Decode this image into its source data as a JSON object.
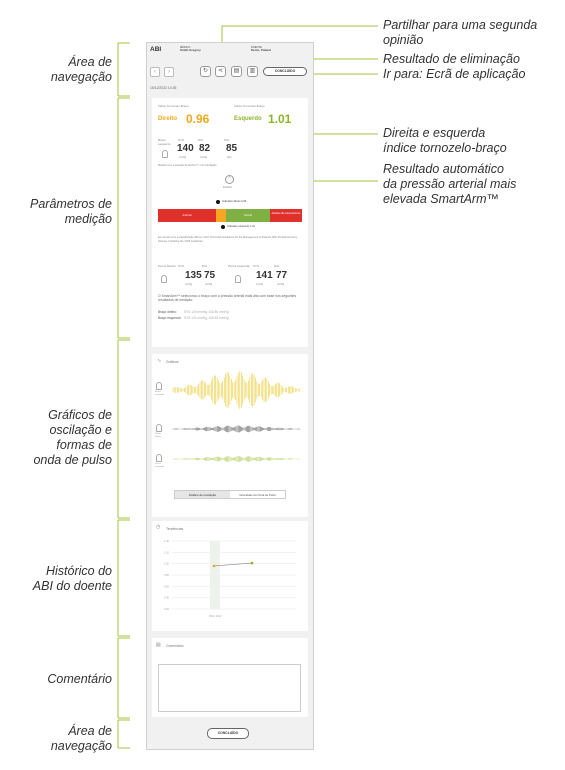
{
  "left_labels": {
    "nav_top": "Área de\nnavegação",
    "params": "Parâmetros de\nmedição",
    "graphs": "Gráficos de\noscilação e\nformas de\nonda de pulso",
    "history": "Histórico do\nABI do doente",
    "comment": "Comentário",
    "nav_bottom": "Área de\nnavegação"
  },
  "right_labels": {
    "share": "Partilhar para uma segunda\nopinião",
    "delete": "Resultado de eliminação",
    "goto": "Ir para: Ecrã de aplicação",
    "abi_index": "Direita e esquerda\níndice tornozelo-braço",
    "auto_bp": "Resultado automático\nda pressão arterial mais\nelevada SmartArm™"
  },
  "header": {
    "app_title": "ABI",
    "field1_label": "MÉDICO",
    "field1_value": "Smith Gregory",
    "field2_label": "DOENTE",
    "field2_value": "Demo, Patient",
    "done_label": "CONCLUÍDO",
    "date": "15/12/2022 14:35"
  },
  "icons": {
    "back": "chevron-left-icon",
    "forward": "chevron-right-icon",
    "refresh": "refresh-icon",
    "share": "share-icon",
    "print": "print-icon",
    "trash": "trash-icon"
  },
  "params": {
    "abi_right_label": "Índice Tornozelo-Braço",
    "abi_left_label": "Índice Tornozelo-Braço",
    "right_word": "Direito",
    "right_value": "0.96",
    "left_word": "Esquerdo",
    "left_value": "1.01",
    "arm_label": "Braço\nesquerdo",
    "sys_label": "SYS",
    "dia_label": "DIA",
    "pulse_label": "PUL",
    "sys": "140",
    "dia": "82",
    "pulse": "85",
    "unit_mmhg": "mmHg",
    "unit_bpm": "bpm",
    "auto_note": "Medido com a seleção SmartArm™ com Fibrilação",
    "details": "Detalhe",
    "marker_right": "Indicador direito 0.96",
    "marker_left": "Indicador esquerdo 1.01",
    "bar_segments": [
      "Anormal",
      "",
      "Normal",
      "Artérias não compressíveis"
    ],
    "bar_colors": [
      "#e0302a",
      "#f6a623",
      "#7fb043",
      "#e0302a"
    ],
    "classification_note": "Em acordo com a classificação ABI em 2017 ACC/AHA Guidelines for the Management of Patients With Peripheral Artery Disease (Updating the 2005 Guideline)",
    "leg_right_label": "Perna Direita",
    "leg_left_label": "Perna esquerda",
    "leg_right_sys": "135",
    "leg_right_dia": "75",
    "leg_left_sys": "141",
    "leg_left_dia": "77",
    "smartarm_text": "O SmartArm™ selecionou o braço com a pressão arterial mais alta com base nos seguintes resultados de medição:",
    "arm_right_line": "Braço direito:",
    "arm_right_values": "SYS 125 mmHg, DIA 80 mmHg",
    "arm_left_line": "Braço esquerdo:",
    "arm_left_values": "SYS 140 mmHg, DIA 82 mmHg"
  },
  "graphs": {
    "title": "Gráficos",
    "rows": [
      "Braço\nesquerdo",
      "Perna\ndireita",
      "Perna\nesquerda"
    ],
    "tab_oscillation": "Gráfico de oscilação",
    "tab_pulse": "Velocidade da Onda de Pulso"
  },
  "history": {
    "title": "Tendências",
    "y_ticks": [
      "1.40",
      "1.20",
      "1.00",
      "0.80",
      "0.60",
      "0.40",
      "0.20"
    ],
    "x_label": "15/12\n2022",
    "points": [
      0.96,
      1.01
    ]
  },
  "comment": {
    "title": "Comentário"
  },
  "footer": {
    "done_label": "CONCLUÍDO"
  },
  "colors": {
    "accent_green": "#a0c43c",
    "orange": "#f0a81c",
    "green_value": "#8bb42a"
  }
}
